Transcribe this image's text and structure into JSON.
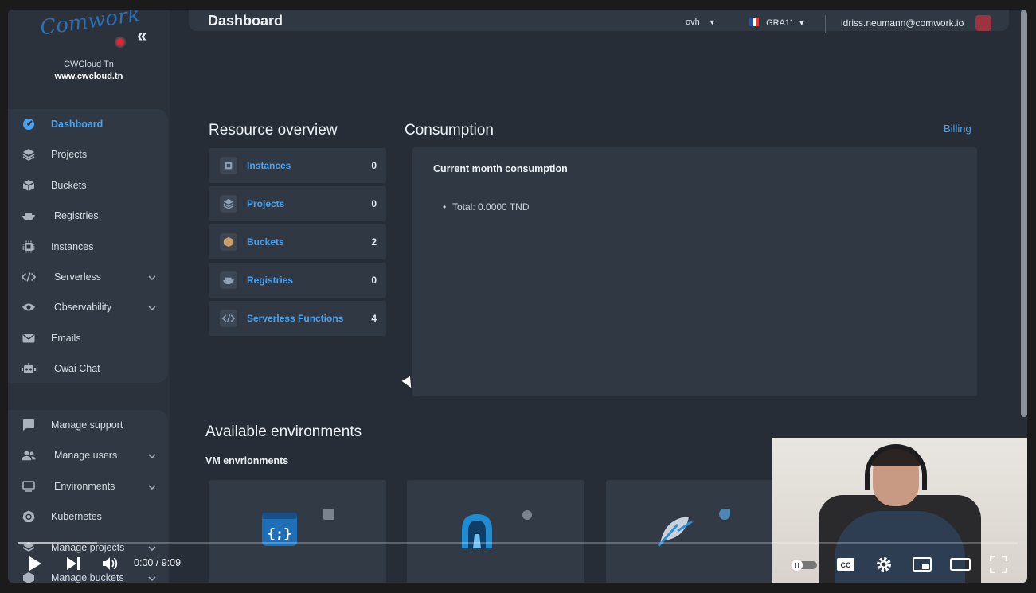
{
  "sidebar": {
    "logo_text": "Comwork",
    "brand_name": "CWCloud Tn",
    "brand_url": "www.cwcloud.tn",
    "main_items": [
      {
        "label": "Dashboard",
        "icon": "dashboard-icon",
        "active": true,
        "expandable": false
      },
      {
        "label": "Projects",
        "icon": "layers-icon",
        "active": false,
        "expandable": false
      },
      {
        "label": "Buckets",
        "icon": "box-icon",
        "active": false,
        "expandable": false
      },
      {
        "label": "Registries",
        "icon": "docker-icon",
        "active": false,
        "expandable": false
      },
      {
        "label": "Instances",
        "icon": "cpu-icon",
        "active": false,
        "expandable": false
      },
      {
        "label": "Serverless",
        "icon": "code-icon",
        "active": false,
        "expandable": true
      },
      {
        "label": "Observability",
        "icon": "eye-icon",
        "active": false,
        "expandable": true
      },
      {
        "label": "Emails",
        "icon": "mail-icon",
        "active": false,
        "expandable": false
      },
      {
        "label": "Cwai Chat",
        "icon": "robot-icon",
        "active": false,
        "expandable": false
      }
    ],
    "admin_items": [
      {
        "label": "Manage support",
        "icon": "chat-icon",
        "expandable": false
      },
      {
        "label": "Manage users",
        "icon": "users-icon",
        "expandable": true
      },
      {
        "label": "Environments",
        "icon": "monitor-icon",
        "expandable": true
      },
      {
        "label": "Kubernetes",
        "icon": "kubernetes-icon",
        "expandable": false
      },
      {
        "label": "Manage projects",
        "icon": "layers-icon",
        "expandable": true
      },
      {
        "label": "Manage buckets",
        "icon": "box-icon",
        "expandable": true
      }
    ]
  },
  "topbar": {
    "title": "Dashboard",
    "provider": "ovh",
    "region": "GRA11",
    "user_email": "idriss.neumann@comwork.io"
  },
  "resource_overview": {
    "title": "Resource overview",
    "rows": [
      {
        "label": "Instances",
        "count": "0",
        "icon": "cpu-icon"
      },
      {
        "label": "Projects",
        "count": "0",
        "icon": "layers-icon"
      },
      {
        "label": "Buckets",
        "count": "2",
        "icon": "box-icon"
      },
      {
        "label": "Registries",
        "count": "0",
        "icon": "docker-icon"
      },
      {
        "label": "Serverless Functions",
        "count": "4",
        "icon": "code-icon"
      }
    ]
  },
  "consumption": {
    "title": "Consumption",
    "billing_link": "Billing",
    "card_title": "Current month consumption",
    "total": "Total: 0.0000 TND"
  },
  "environments": {
    "title": "Available environments",
    "subtitle": "VM envrionments",
    "cards": [
      {
        "icon": "code-brackets-icon"
      },
      {
        "icon": "tunnel-icon"
      },
      {
        "icon": "feather-icon"
      }
    ]
  },
  "video_player": {
    "time": "0:00 / 9:09",
    "progress_fraction": 0.08,
    "controls": [
      "play-icon",
      "next-icon",
      "volume-icon",
      "autoplay-toggle-icon",
      "captions-icon",
      "settings-icon",
      "miniplayer-icon",
      "theater-icon",
      "fullscreen-icon"
    ]
  },
  "colors": {
    "accent": "#4aa3f0",
    "background": "#262d36",
    "panel": "#303843"
  }
}
